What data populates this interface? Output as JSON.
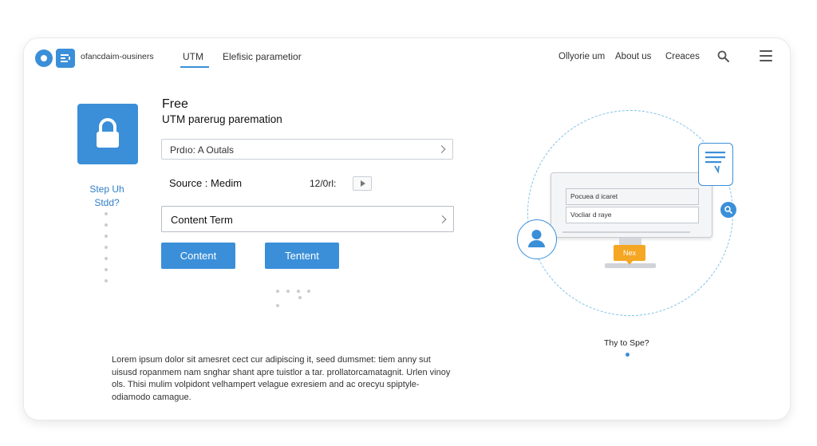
{
  "header": {
    "brand": "ofancdaim-ousiners",
    "tabs": [
      {
        "label": "UTM",
        "active": true
      },
      {
        "label": "Elefisic parametior",
        "active": false
      }
    ],
    "right_links": [
      "Ollyorie um",
      "About us",
      "Creaces"
    ],
    "icons": {
      "search": "search-icon",
      "menu": "hamburger-menu-icon"
    }
  },
  "step": {
    "label_line1": "Step Uh",
    "label_line2": "Stdd?",
    "icon": "lock-icon"
  },
  "form": {
    "title": "Free",
    "subtitle": "UTM parerug paremation",
    "first_field": "Prdıo:  A Outals",
    "source_label": "Source : Medim",
    "date_value": "12/0rl:",
    "content_term": "Content Term",
    "buttons": [
      "Content",
      "Tentent"
    ]
  },
  "body_text": "Lorem ipsum dolor sit amesret cect cur adipiscing it, seed dumsmet: tiem anny sut uisusd ropanmem nam snghar shant apre tuistlor a tar. prollatorcamatagnit. Urlen vinoy ols. Thisi mulim volpidont velhampert velague exresiem and ac orecyu spiptyle-odiamodo camague.",
  "illustration": {
    "field1": "Pocuea d icaret",
    "field2": "Vocliar d raye",
    "badge": "Nex",
    "try_label": "Thy to Spe?"
  },
  "colors": {
    "accent": "#3b8fd8",
    "badge": "#f5a623",
    "dashed_ring": "#7ec1e8"
  }
}
